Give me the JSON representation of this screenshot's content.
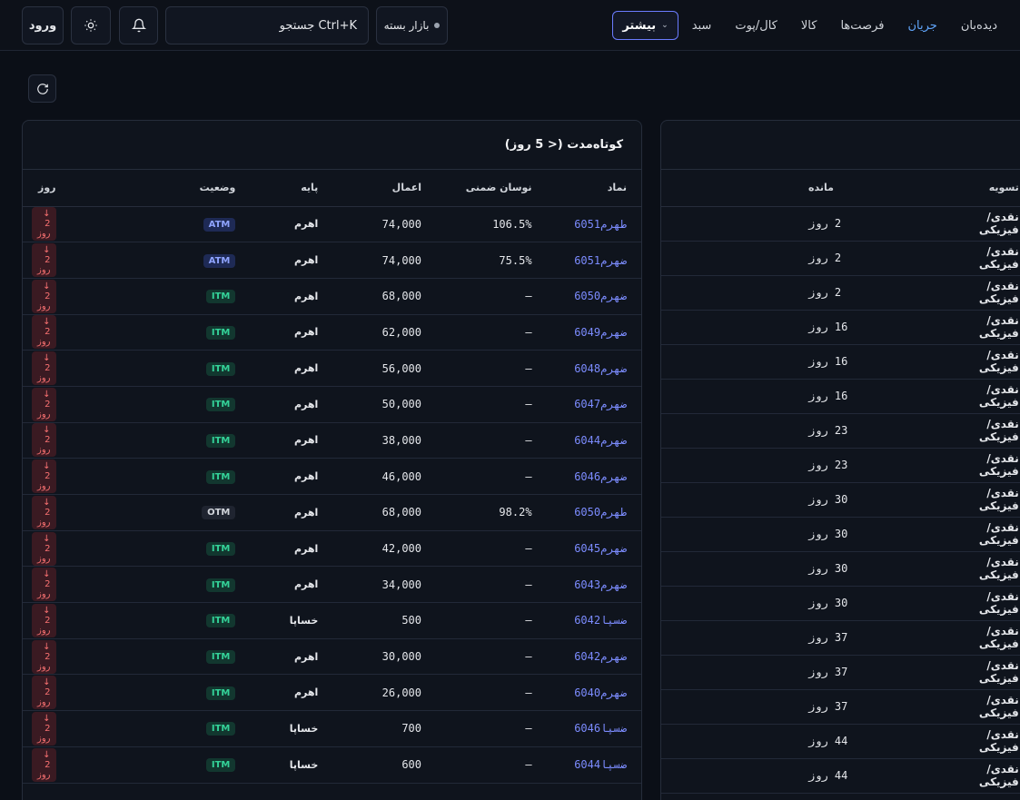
{
  "nav": {
    "items": [
      "دیده‌بان",
      "جریان",
      "فرصت‌ها",
      "کالا",
      "کال/پوت",
      "سبد"
    ],
    "active_index": 1,
    "more_label": "بیشتر"
  },
  "market_status": "بازار بسته",
  "search": {
    "placeholder": "جستجو Ctrl+K"
  },
  "login_label": "ورود",
  "left_panel": {
    "title": "کوتاه‌مدت (< 5 روز)",
    "columns": [
      "نماد",
      "نوسان ضمنی",
      "اعمال",
      "پایه",
      "وضعیت",
      "روز"
    ],
    "rows": [
      {
        "symbol": "طهرم6051",
        "iv": "106.5%",
        "strike": "74,000",
        "base": "اهرم",
        "status": "ATM",
        "days": "↓ 2 روز"
      },
      {
        "symbol": "ضهرم6051",
        "iv": "75.5%",
        "strike": "74,000",
        "base": "اهرم",
        "status": "ATM",
        "days": "↓ 2 روز"
      },
      {
        "symbol": "ضهرم6050",
        "iv": "—",
        "strike": "68,000",
        "base": "اهرم",
        "status": "ITM",
        "days": "↓ 2 روز"
      },
      {
        "symbol": "ضهرم6049",
        "iv": "—",
        "strike": "62,000",
        "base": "اهرم",
        "status": "ITM",
        "days": "↓ 2 روز"
      },
      {
        "symbol": "ضهرم6048",
        "iv": "—",
        "strike": "56,000",
        "base": "اهرم",
        "status": "ITM",
        "days": "↓ 2 روز"
      },
      {
        "symbol": "ضهرم6047",
        "iv": "—",
        "strike": "50,000",
        "base": "اهرم",
        "status": "ITM",
        "days": "↓ 2 روز"
      },
      {
        "symbol": "ضهرم6044",
        "iv": "—",
        "strike": "38,000",
        "base": "اهرم",
        "status": "ITM",
        "days": "↓ 2 روز"
      },
      {
        "symbol": "ضهرم6046",
        "iv": "—",
        "strike": "46,000",
        "base": "اهرم",
        "status": "ITM",
        "days": "↓ 2 روز"
      },
      {
        "symbol": "طهرم6050",
        "iv": "98.2%",
        "strike": "68,000",
        "base": "اهرم",
        "status": "OTM",
        "days": "↓ 2 روز"
      },
      {
        "symbol": "ضهرم6045",
        "iv": "—",
        "strike": "42,000",
        "base": "اهرم",
        "status": "ITM",
        "days": "↓ 2 روز"
      },
      {
        "symbol": "ضهرم6043",
        "iv": "—",
        "strike": "34,000",
        "base": "اهرم",
        "status": "ITM",
        "days": "↓ 2 روز"
      },
      {
        "symbol": "ضسپا6042",
        "iv": "—",
        "strike": "500",
        "base": "خساپا",
        "status": "ITM",
        "days": "↓ 2 روز"
      },
      {
        "symbol": "ضهرم6042",
        "iv": "—",
        "strike": "30,000",
        "base": "اهرم",
        "status": "ITM",
        "days": "↓ 2 روز"
      },
      {
        "symbol": "ضهرم6040",
        "iv": "—",
        "strike": "26,000",
        "base": "اهرم",
        "status": "ITM",
        "days": "↓ 2 روز"
      },
      {
        "symbol": "ضسپا6046",
        "iv": "—",
        "strike": "700",
        "base": "خساپا",
        "status": "ITM",
        "days": "↓ 2 روز"
      },
      {
        "symbol": "ضسپا6044",
        "iv": "—",
        "strike": "600",
        "base": "خساپا",
        "status": "ITM",
        "days": "↓ 2 روز"
      }
    ]
  },
  "right_panel": {
    "columns": [
      "تسویه",
      "مانده"
    ],
    "rows": [
      {
        "settlement": "نقدی/فیزیکی",
        "remaining": "2 روز",
        "urgent": true
      },
      {
        "settlement": "نقدی/فیزیکی",
        "remaining": "2 روز",
        "urgent": true
      },
      {
        "settlement": "نقدی/فیزیکی",
        "remaining": "2 روز",
        "urgent": true
      },
      {
        "settlement": "نقدی/فیزیکی",
        "remaining": "16 روز",
        "urgent": false
      },
      {
        "settlement": "نقدی/فیزیکی",
        "remaining": "16 روز",
        "urgent": false
      },
      {
        "settlement": "نقدی/فیزیکی",
        "remaining": "16 روز",
        "urgent": false
      },
      {
        "settlement": "نقدی/فیزیکی",
        "remaining": "23 روز",
        "urgent": false
      },
      {
        "settlement": "نقدی/فیزیکی",
        "remaining": "23 روز",
        "urgent": false
      },
      {
        "settlement": "نقدی/فیزیکی",
        "remaining": "30 روز",
        "urgent": false
      },
      {
        "settlement": "نقدی/فیزیکی",
        "remaining": "30 روز",
        "urgent": false
      },
      {
        "settlement": "نقدی/فیزیکی",
        "remaining": "30 روز",
        "urgent": false
      },
      {
        "settlement": "نقدی/فیزیکی",
        "remaining": "30 روز",
        "urgent": false
      },
      {
        "settlement": "نقدی/فیزیکی",
        "remaining": "37 روز",
        "urgent": false
      },
      {
        "settlement": "نقدی/فیزیکی",
        "remaining": "37 روز",
        "urgent": false
      },
      {
        "settlement": "نقدی/فیزیکی",
        "remaining": "37 روز",
        "urgent": false
      },
      {
        "settlement": "نقدی/فیزیکی",
        "remaining": "44 روز",
        "urgent": false
      },
      {
        "settlement": "نقدی/فیزیکی",
        "remaining": "44 روز",
        "urgent": false
      }
    ]
  },
  "colors": {
    "accent": "#60a5fa",
    "symbol": "#7c8cff",
    "danger": "#f87171",
    "itm": "#34d399"
  }
}
